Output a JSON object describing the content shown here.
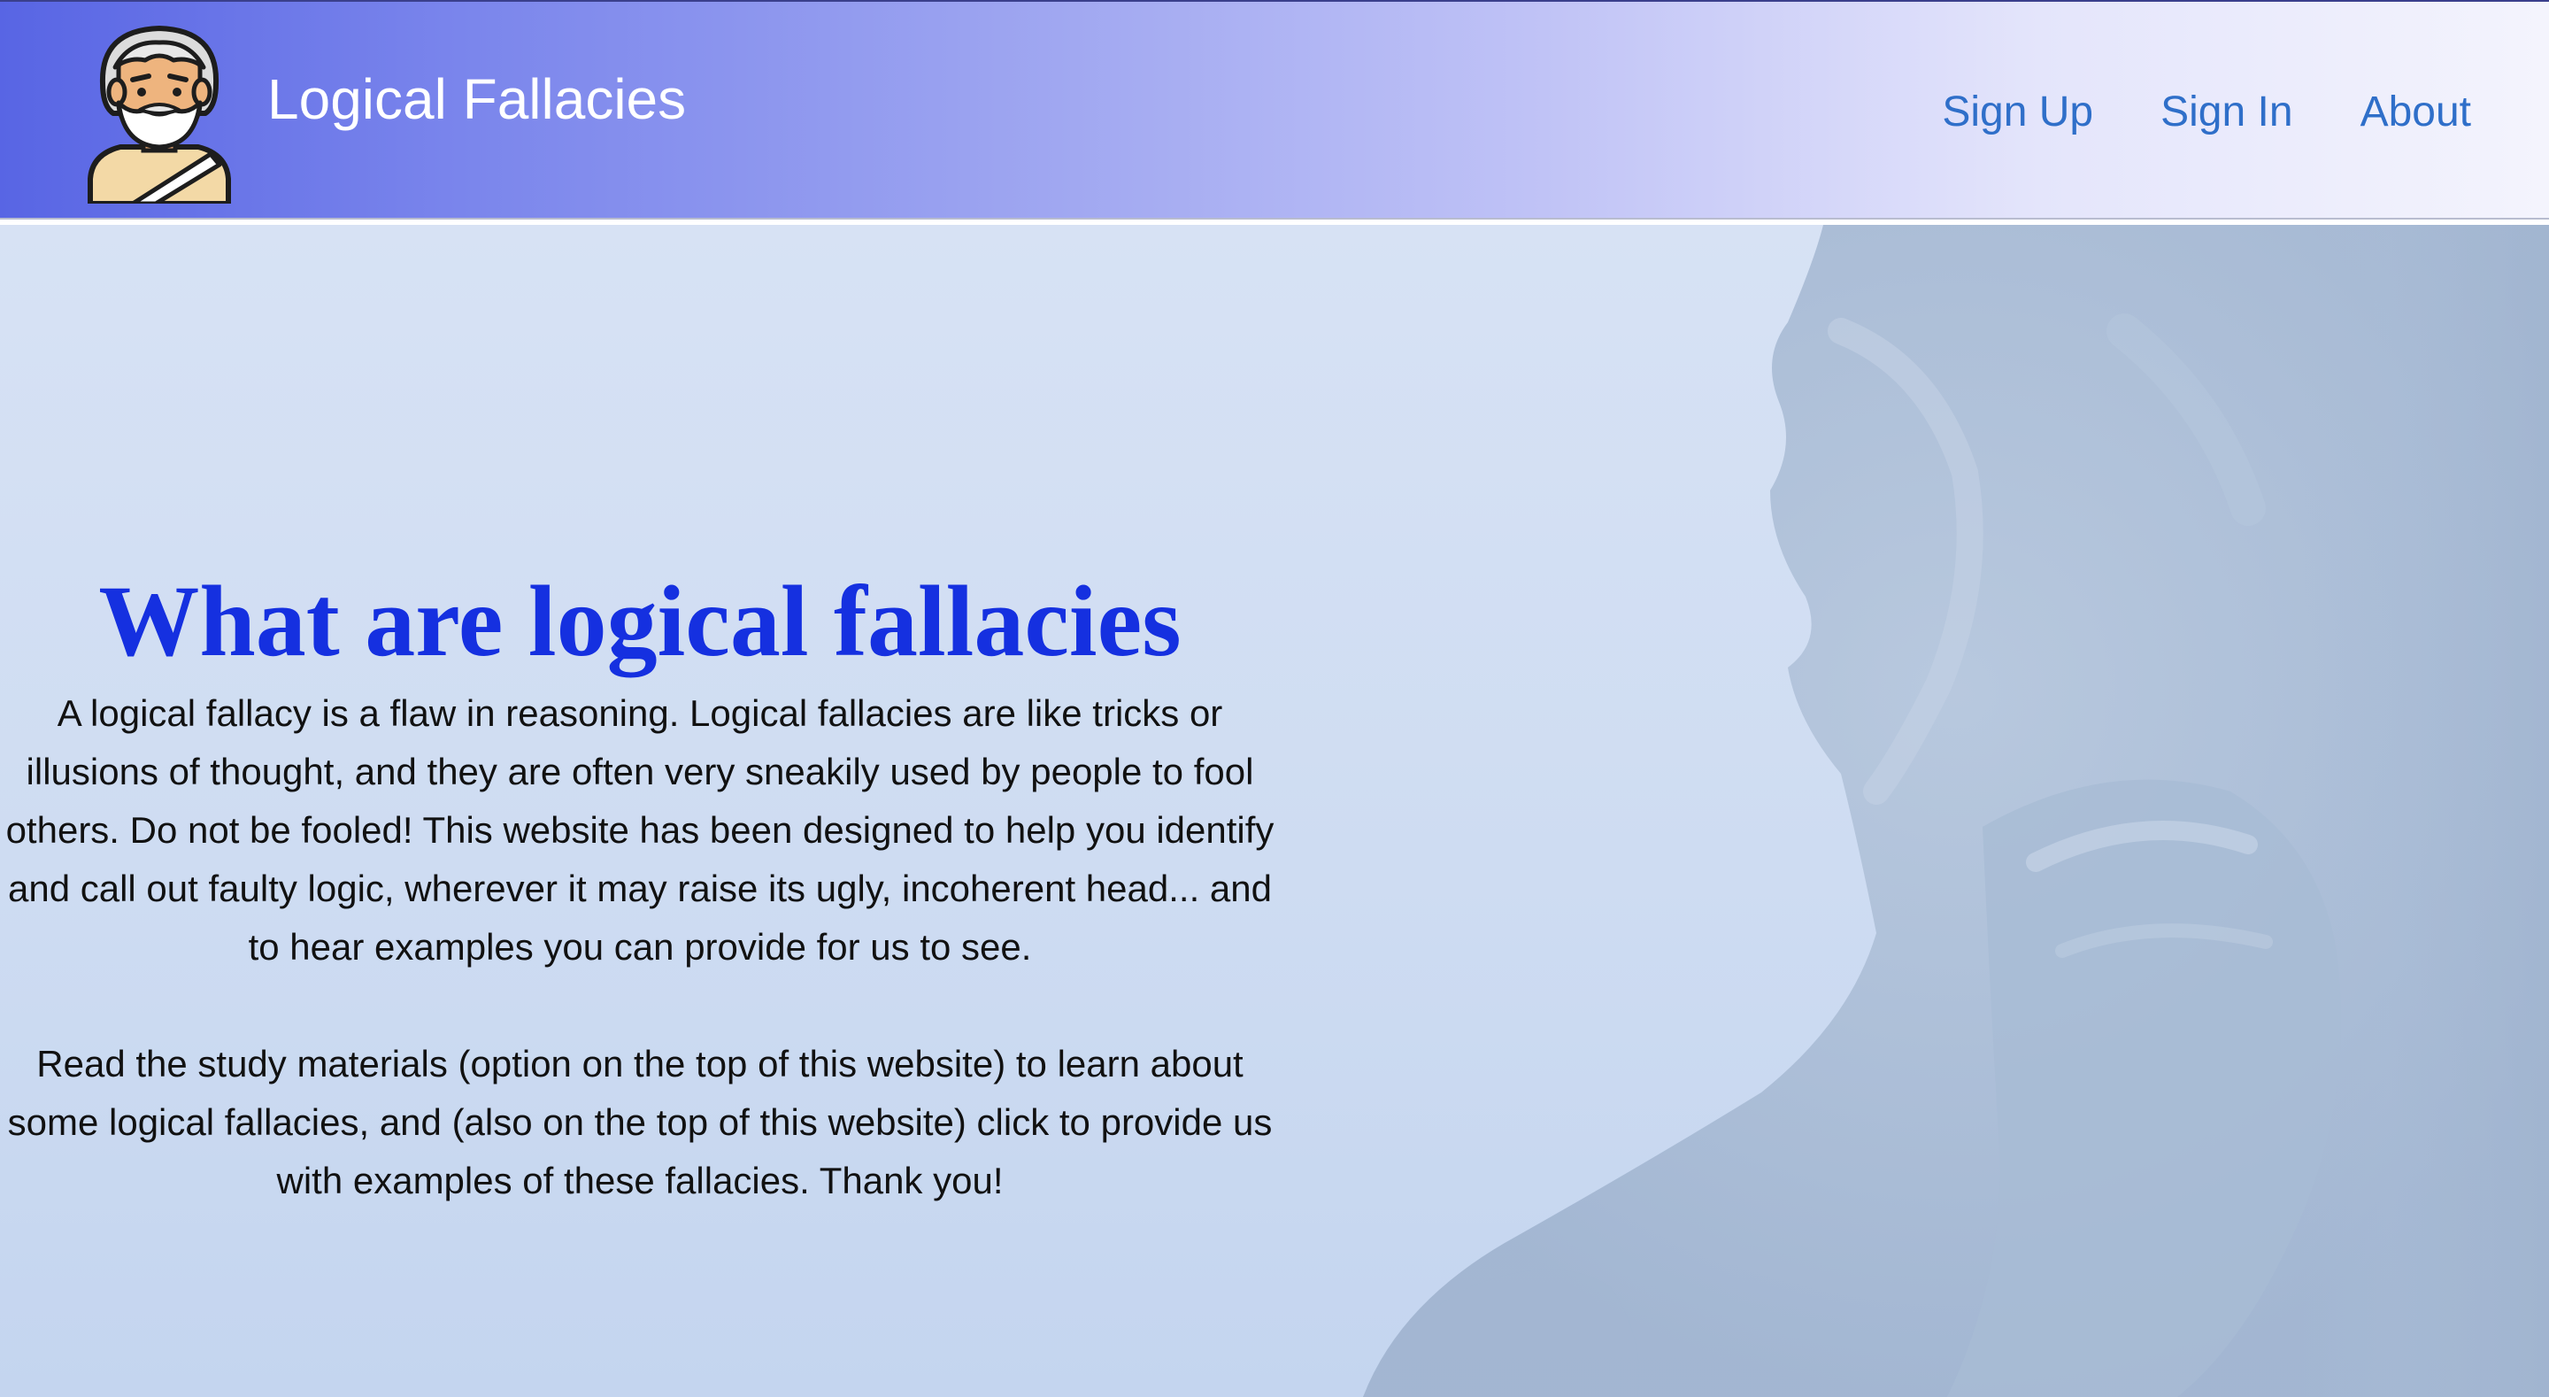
{
  "header": {
    "brand": "Logical Fallacies",
    "logo_icon": "philosopher-avatar-icon",
    "nav": [
      {
        "label": "Sign Up"
      },
      {
        "label": "Sign In"
      },
      {
        "label": "About"
      }
    ],
    "colors": {
      "gradient_start": "#5865e4",
      "gradient_end": "#f4f4fd",
      "link": "#2f6fc9"
    }
  },
  "hero": {
    "title": "What are logical fallacies",
    "paragraph1": "A logical fallacy is a flaw in reasoning. Logical fallacies are like tricks or illusions of thought, and they are often very sneakily used by people to fool others. Do not be fooled! This website has been designed to help you identify and call out faulty logic, wherever it may raise its ugly, incoherent head... and to hear examples you can provide for us to see.",
    "paragraph2": "Read the study materials (option on the top of this website) to learn about some logical fallacies, and (also on the top of this website) click to provide us with examples of these fallacies. Thank you!",
    "background_image": "thinker-statue-image",
    "colors": {
      "title": "#1530e0",
      "background": "#d2def3"
    }
  }
}
